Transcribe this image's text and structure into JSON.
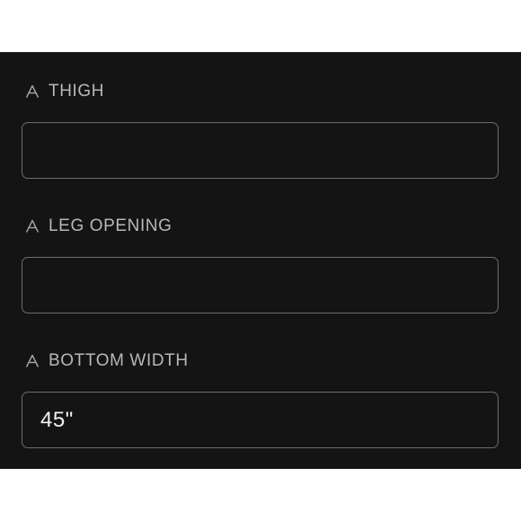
{
  "form": {
    "fields": [
      {
        "label": "THIGH",
        "icon": "ruler-a-icon",
        "value": ""
      },
      {
        "label": "LEG OPENING",
        "icon": "ruler-a-icon",
        "value": ""
      },
      {
        "label": "BOTTOM WIDTH",
        "icon": "ruler-a-icon",
        "value": "45\""
      }
    ]
  },
  "colors": {
    "background": "#141414",
    "label": "#b8b8b8",
    "border": "#6d6d6d",
    "value": "#f2f2f2"
  }
}
